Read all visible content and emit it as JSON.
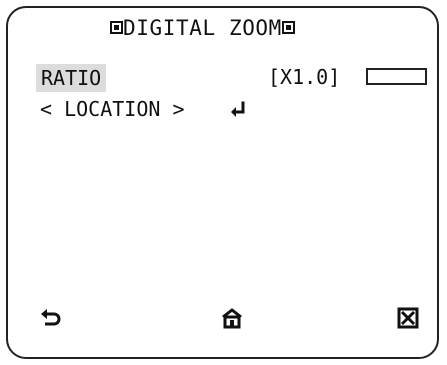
{
  "menu": {
    "title": "DIGITAL ZOOM",
    "title_left_icon": "square-bullet-icon",
    "title_right_icon": "square-bullet-icon"
  },
  "ratio": {
    "label": "RATIO",
    "value": "[X1.0]",
    "bar_icon": "ratio-bar"
  },
  "location": {
    "label": "< LOCATION >",
    "enter_icon": "enter-icon"
  },
  "footer": {
    "back_icon": "back-icon",
    "home_icon": "home-icon",
    "close_icon": "close-icon"
  },
  "colors": {
    "background": "#ffffff",
    "text": "#111111",
    "highlight": "#dcdcdc",
    "frame": "#222222"
  }
}
